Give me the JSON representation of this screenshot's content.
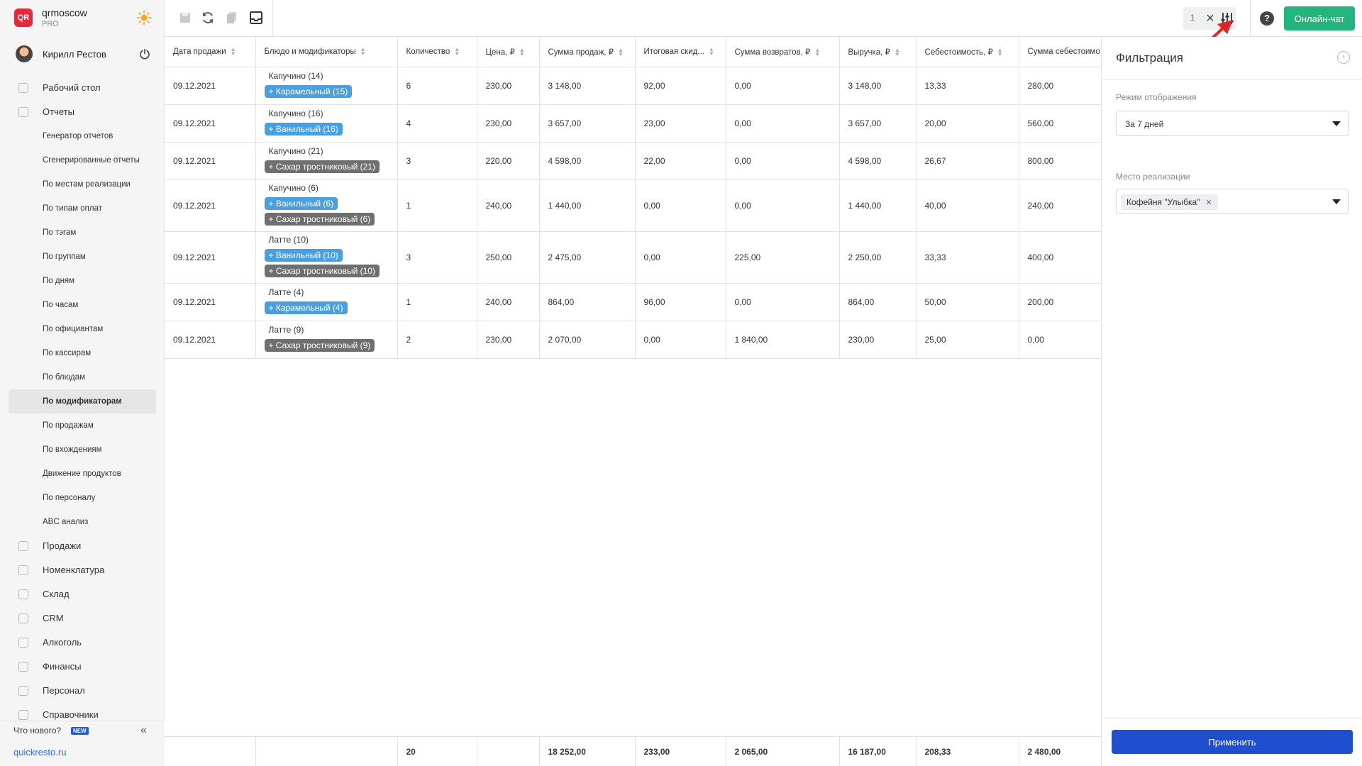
{
  "brand": {
    "name": "qrmoscow",
    "plan": "PRO",
    "logo_text": "QR"
  },
  "user": {
    "name": "Кирилл Рестов"
  },
  "nav": {
    "dashboard": "Рабочий стол",
    "reports": "Отчеты",
    "report_items": [
      "Генератор отчетов",
      "Сгенерированные отчеты",
      "По местам реализации",
      "По типам оплат",
      "По тэгам",
      "По группам",
      "По дням",
      "По часам",
      "По официантам",
      "По кассирам",
      "По блюдам",
      "По модификаторам",
      "По продажам",
      "По вхождениям",
      "Движение продуктов",
      "По персоналу",
      "ABC анализ"
    ],
    "active_report": "По модификаторам",
    "sections": [
      "Продажи",
      "Номенклатура",
      "Склад",
      "CRM",
      "Алкоголь",
      "Финансы",
      "Персонал",
      "Справочники"
    ]
  },
  "footer": {
    "whats_new": "Что нового?",
    "new_badge": "NEW",
    "site": "quickresto.ru"
  },
  "topbar": {
    "filter_count": "1",
    "chat_label": "Онлайн-чат",
    "help": "?"
  },
  "table": {
    "columns": [
      "Дата продажи",
      "Блюдо и модификаторы",
      "Количество",
      "Цена, ₽",
      "Сумма продаж, ₽",
      "Итоговая скид...",
      "Сумма возвратов, ₽",
      "Выручка, ₽",
      "Себестоимость, ₽",
      "Сумма себестоимо"
    ],
    "rows": [
      {
        "date": "09.12.2021",
        "dish": "Капучино (14)",
        "mods": [
          {
            "label": "+ Карамельный (15)",
            "color": "blue"
          }
        ],
        "qty": "6",
        "price": "230,00",
        "sales": "3 148,00",
        "discount": "92,00",
        "returns": "0,00",
        "revenue": "3 148,00",
        "cost": "13,33",
        "cost_sum": "280,00"
      },
      {
        "date": "09.12.2021",
        "dish": "Капучино (16)",
        "mods": [
          {
            "label": "+ Ванильный (16)",
            "color": "blue"
          }
        ],
        "qty": "4",
        "price": "230,00",
        "sales": "3 657,00",
        "discount": "23,00",
        "returns": "0,00",
        "revenue": "3 657,00",
        "cost": "20,00",
        "cost_sum": "560,00"
      },
      {
        "date": "09.12.2021",
        "dish": "Капучино (21)",
        "mods": [
          {
            "label": "+ Сахар тростниковый (21)",
            "color": "gray"
          }
        ],
        "qty": "3",
        "price": "220,00",
        "sales": "4 598,00",
        "discount": "22,00",
        "returns": "0,00",
        "revenue": "4 598,00",
        "cost": "26,67",
        "cost_sum": "800,00"
      },
      {
        "date": "09.12.2021",
        "dish": "Капучино (6)",
        "mods": [
          {
            "label": "+ Ванильный (6)",
            "color": "blue"
          },
          {
            "label": "+ Сахар тростниковый (6)",
            "color": "gray"
          }
        ],
        "qty": "1",
        "price": "240,00",
        "sales": "1 440,00",
        "discount": "0,00",
        "returns": "0,00",
        "revenue": "1 440,00",
        "cost": "40,00",
        "cost_sum": "240,00"
      },
      {
        "date": "09.12.2021",
        "dish": "Латте (10)",
        "mods": [
          {
            "label": "+ Ванильный (10)",
            "color": "blue"
          },
          {
            "label": "+ Сахар тростниковый (10)",
            "color": "gray"
          }
        ],
        "qty": "3",
        "price": "250,00",
        "sales": "2 475,00",
        "discount": "0,00",
        "returns": "225,00",
        "revenue": "2 250,00",
        "cost": "33,33",
        "cost_sum": "400,00"
      },
      {
        "date": "09.12.2021",
        "dish": "Латте (4)",
        "mods": [
          {
            "label": "+ Карамельный (4)",
            "color": "blue"
          }
        ],
        "qty": "1",
        "price": "240,00",
        "sales": "864,00",
        "discount": "96,00",
        "returns": "0,00",
        "revenue": "864,00",
        "cost": "50,00",
        "cost_sum": "200,00"
      },
      {
        "date": "09.12.2021",
        "dish": "Латте (9)",
        "mods": [
          {
            "label": "+ Сахар тростниковый (9)",
            "color": "gray"
          }
        ],
        "qty": "2",
        "price": "230,00",
        "sales": "2 070,00",
        "discount": "0,00",
        "returns": "1 840,00",
        "revenue": "230,00",
        "cost": "25,00",
        "cost_sum": "0,00"
      }
    ],
    "totals": {
      "qty": "20",
      "sales": "18 252,00",
      "discount": "233,00",
      "returns": "2 065,00",
      "revenue": "16 187,00",
      "cost": "208,33",
      "cost_sum": "2 480,00"
    }
  },
  "filter_panel": {
    "title": "Фильтрация",
    "mode_label": "Режим отображения",
    "mode_value": "За 7 дней",
    "place_label": "Место реализации",
    "place_chip": "Кофейня \"Улыбка\"",
    "apply_label": "Применить"
  },
  "colors": {
    "accent": "#1f4fce",
    "chat": "#24b47e",
    "tag_blue": "#4a9fe0",
    "tag_gray": "#6f6f6f",
    "brand": "#e4293b"
  }
}
